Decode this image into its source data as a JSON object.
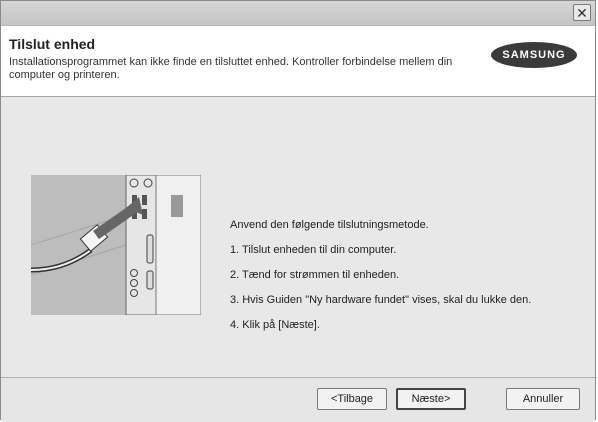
{
  "header": {
    "title": "Tilslut enhed",
    "description": "Installationsprogrammet kan ikke finde en tilsluttet enhed. Kontroller forbindelse mellem din computer og printeren.",
    "logo_text": "SAMSUNG"
  },
  "main": {
    "intro": "Anvend den følgende tilslutningsmetode.",
    "steps": [
      "1. Tilslut enheden til din computer.",
      "2. Tænd for strømmen til enheden.",
      "3. Hvis Guiden \"Ny hardware fundet\" vises, skal du lukke den.",
      "4. Klik på [Næste]."
    ]
  },
  "buttons": {
    "back": "<Tilbage",
    "next": "Næste>",
    "cancel": "Annuller"
  },
  "titlebar": {
    "close_glyph": "✕"
  }
}
